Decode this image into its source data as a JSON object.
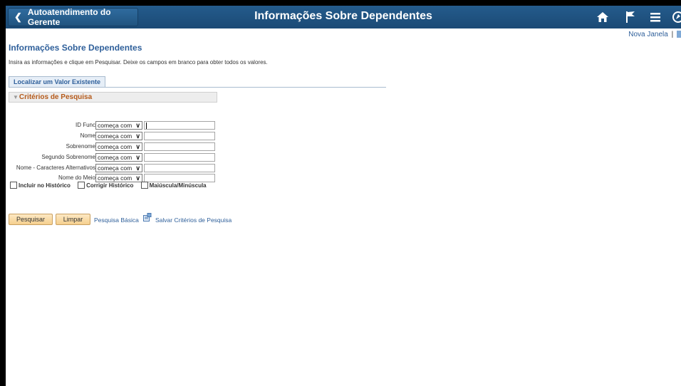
{
  "header": {
    "back_label": "Autoatendimento do Gerente",
    "title": "Informações Sobre Dependentes"
  },
  "topright": {
    "new_window": "Nova Janela",
    "separator": "|"
  },
  "page": {
    "heading": "Informações Sobre Dependentes",
    "instructions": "Insira as informações e clique em Pesquisar. Deixe os campos em branco para obter todos os valores.",
    "tab_label": "Localizar um Valor Existente",
    "section_title": "Critérios de Pesquisa"
  },
  "criteria": [
    {
      "label": "ID Func",
      "operator": "começa com",
      "value": ""
    },
    {
      "label": "Nome",
      "operator": "começa com",
      "value": ""
    },
    {
      "label": "Sobrenome",
      "operator": "começa com",
      "value": ""
    },
    {
      "label": "Segundo Sobrenome",
      "operator": "começa com",
      "value": ""
    },
    {
      "label": "Nome - Caracteres Alternativos",
      "operator": "começa com",
      "value": ""
    },
    {
      "label": "Nome do Meio",
      "operator": "começa com",
      "value": ""
    }
  ],
  "checkboxes": {
    "history": "Incluir no Histórico",
    "correct": "Corrigir Histórico",
    "case": "Maiúscula/Minúscula"
  },
  "actions": {
    "search": "Pesquisar",
    "clear": "Limpar",
    "basic": "Pesquisa Básica",
    "save": "Salvar Critérios de Pesquisa"
  },
  "colors": {
    "header": "#1f5080",
    "link": "#2e5f9a",
    "section_title": "#b55a1a",
    "button": "#f5cf8e"
  },
  "icons": [
    "chevron-left-icon",
    "home-icon",
    "flag-icon",
    "menu-icon",
    "navbar-icon",
    "save-search-icon"
  ]
}
